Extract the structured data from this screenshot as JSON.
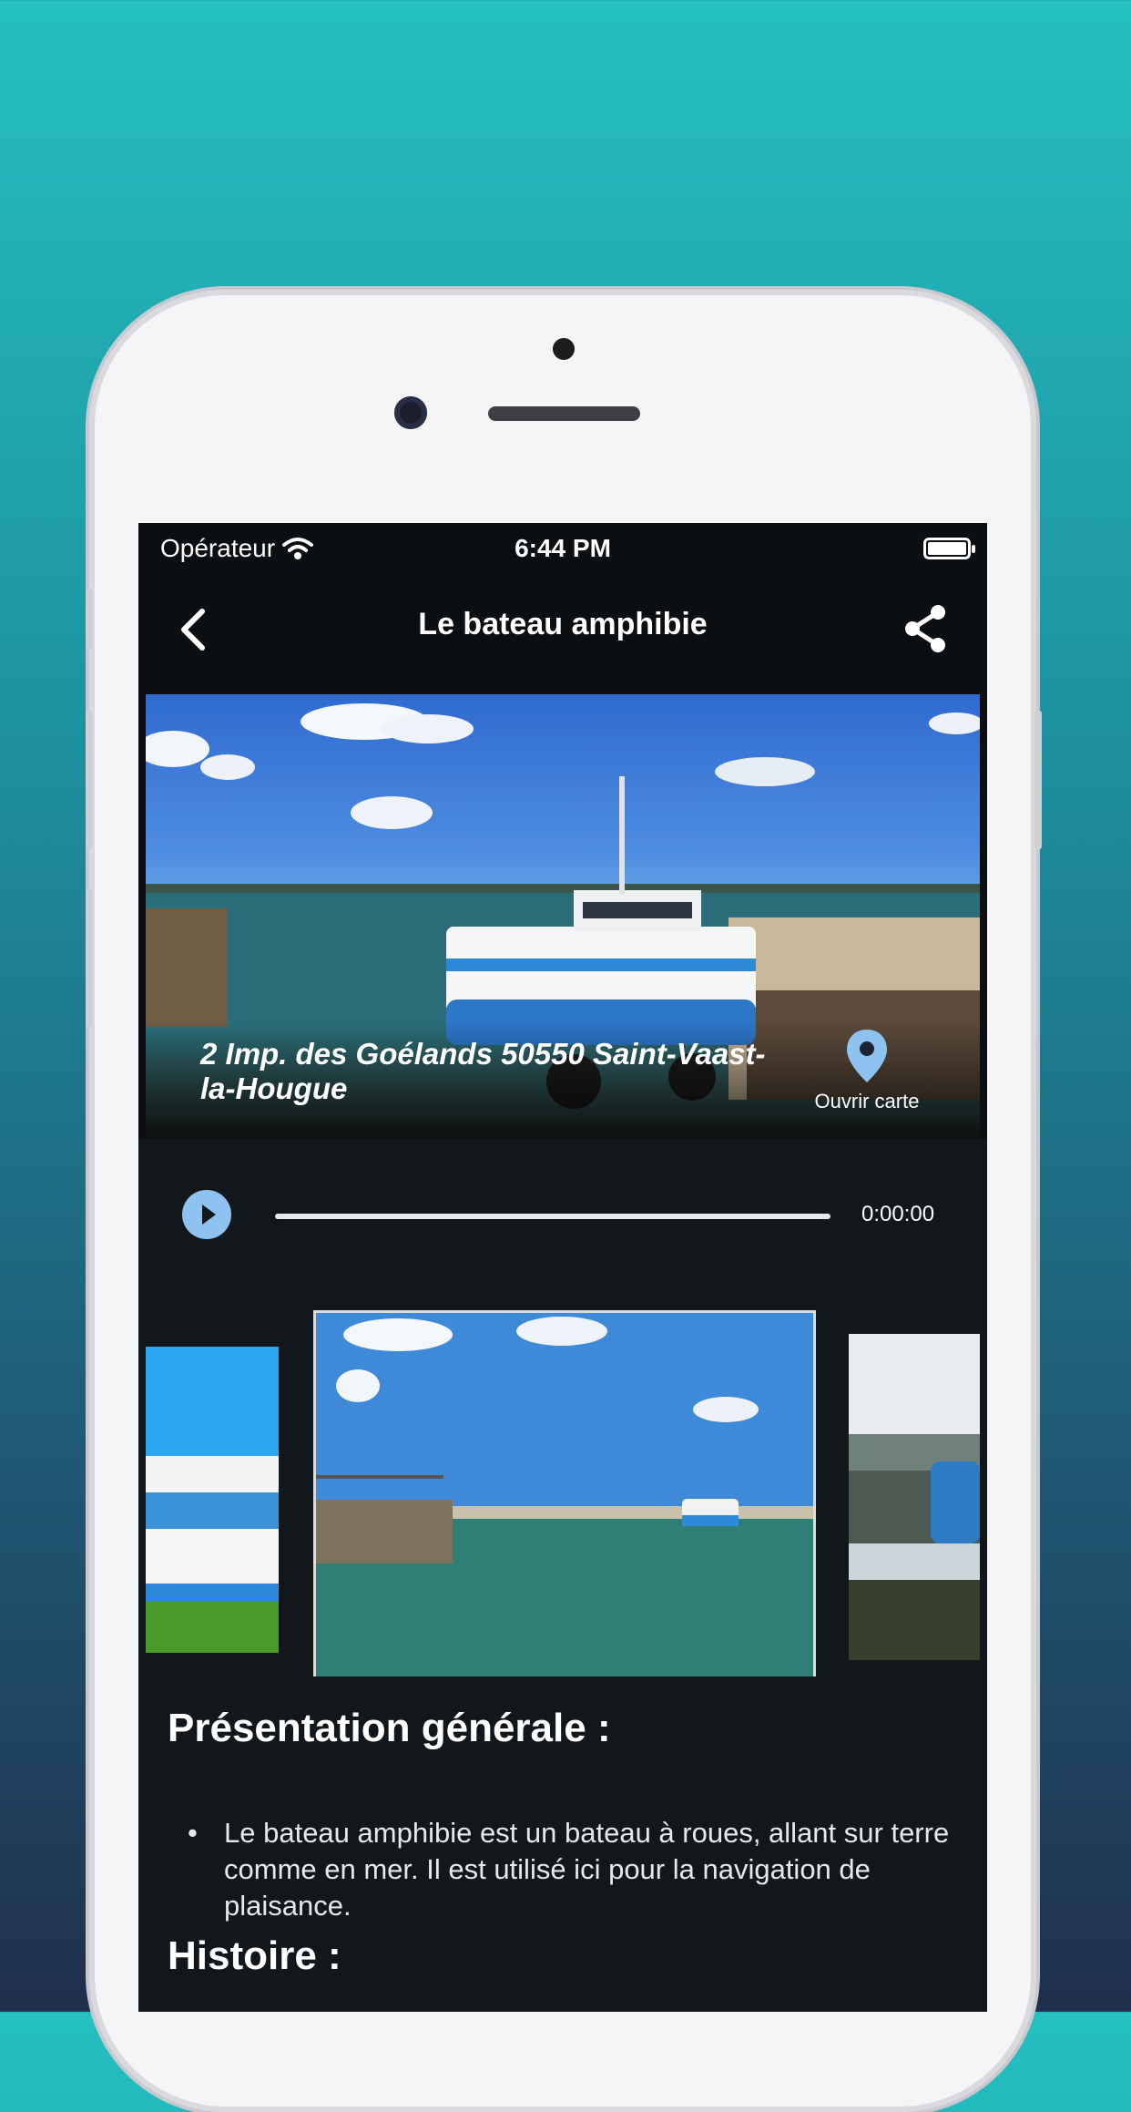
{
  "status_bar": {
    "operator": "Opérateur",
    "time": "6:44 PM"
  },
  "nav": {
    "title": "Le bateau amphibie"
  },
  "hero": {
    "address": "2 Imp. des Goélands 50550 Saint-Vaast-la-Hougue",
    "map_label": "Ouvrir carte"
  },
  "audio": {
    "time": "0:00:00",
    "progress": 0.0
  },
  "content": {
    "section1_title": "Présentation générale :",
    "section1_bullet": "Le bateau amphibie est un bateau à roues, allant sur terre comme en mer. Il est utilisé ici pour la navigation de plaisance.",
    "section2_title": "Histoire :"
  },
  "colors": {
    "accent": "#8ec2f0",
    "background": "#0c0f12",
    "panel": "#12171c"
  }
}
